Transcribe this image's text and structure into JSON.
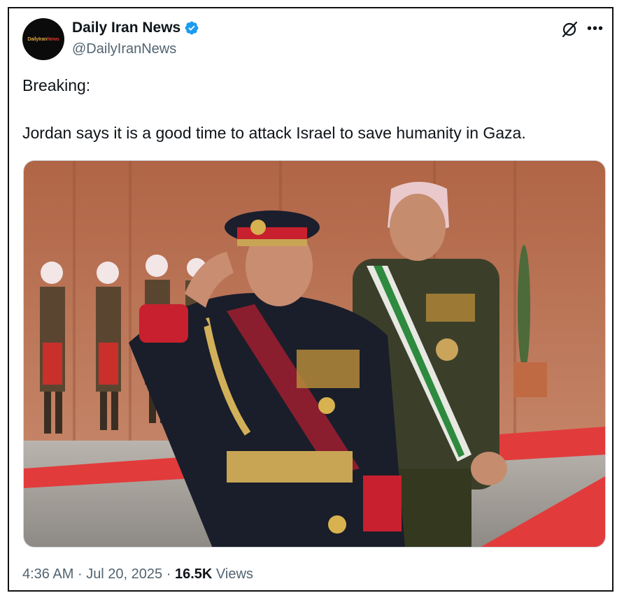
{
  "author": {
    "display_name": "Daily Iran News",
    "handle": "@DailyIranNews",
    "avatar_text_part1": "Daily",
    "avatar_text_part2": "Iran",
    "avatar_text_part3": "News",
    "verified": true
  },
  "icons": {
    "verified": "verified-badge-icon",
    "grok": "grok-icon",
    "more": "more-options-icon"
  },
  "tweet": {
    "line1": "Breaking:",
    "line2": "Jordan says it is a good time to attack Israel to save humanity in Gaza."
  },
  "meta": {
    "time": "4:36 AM",
    "separator": "·",
    "date": "Jul 20, 2025",
    "views_count": "16.5K",
    "views_label": "Views"
  },
  "colors": {
    "text_primary": "#0f1419",
    "text_secondary": "#536471",
    "verified_blue": "#1d9bf0",
    "carpet_red": "#e23b3b",
    "wall_terracotta": "#b86a4a"
  }
}
